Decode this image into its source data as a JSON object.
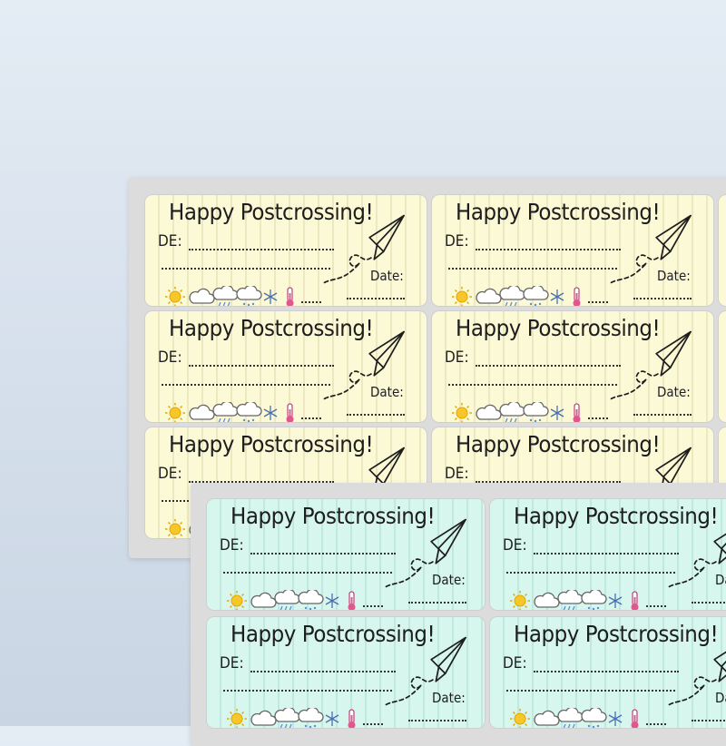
{
  "labels": {
    "title": "Happy Postcrossing!",
    "de": "DE:",
    "date": "Date:"
  },
  "sheets": [
    {
      "name": "yellow",
      "color": "#fcf9d6"
    },
    {
      "name": "mint",
      "color": "#d6f6ee"
    }
  ],
  "weather_icons": [
    "sun-icon",
    "cloud-icon",
    "rain-cloud-icon",
    "drizzle-cloud-icon",
    "snowflake-icon",
    "thermometer-icon"
  ]
}
